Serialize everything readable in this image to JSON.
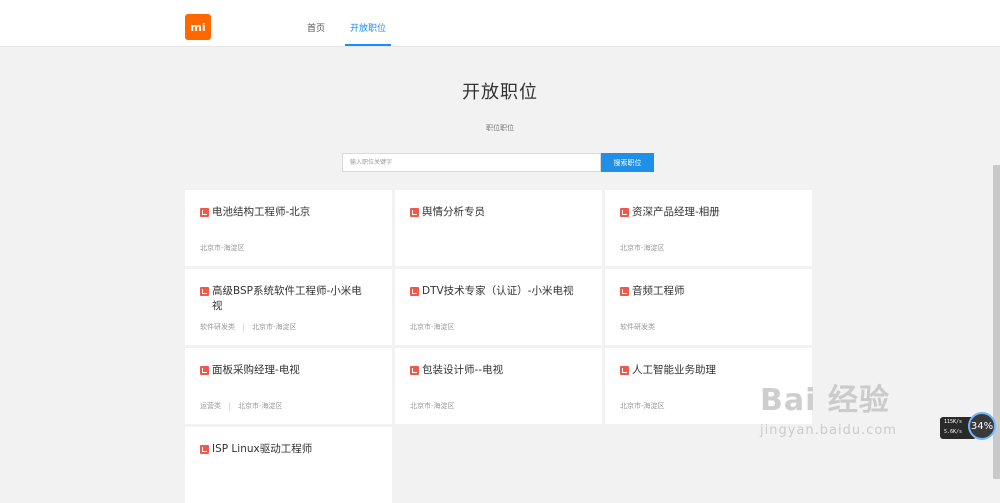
{
  "header": {
    "logo_text": "mi",
    "nav": [
      {
        "label": "首页",
        "active": false
      },
      {
        "label": "开放职位",
        "active": true
      }
    ]
  },
  "hero": {
    "title": "开放职位",
    "subtitle": "职位职位"
  },
  "search": {
    "placeholder": "输入职位关键字",
    "value": "",
    "button_label": "搜索职位"
  },
  "jobs": [
    {
      "title": "电池结构工程师-北京",
      "tags": [
        "北京市-海淀区"
      ]
    },
    {
      "title": "舆情分析专员",
      "tags": []
    },
    {
      "title": "资深产品经理-相册",
      "tags": [
        "北京市-海淀区"
      ]
    },
    {
      "title": "高级BSP系统软件工程师-小米电视",
      "tags": [
        "软件研发类",
        "北京市-海淀区"
      ]
    },
    {
      "title": "DTV技术专家（认证）-小米电视",
      "tags": [
        "北京市-海淀区"
      ]
    },
    {
      "title": "音频工程师",
      "tags": [
        "软件研发类"
      ]
    },
    {
      "title": "面板采购经理-电视",
      "tags": [
        "运营类",
        "北京市-海淀区"
      ]
    },
    {
      "title": "包装设计师--电视",
      "tags": [
        "北京市-海淀区"
      ]
    },
    {
      "title": "人工智能业务助理",
      "tags": [
        "北京市-海淀区"
      ]
    },
    {
      "title": "ISP Linux驱动工程师",
      "tags": []
    }
  ],
  "watermark": {
    "top": "Bai 经验",
    "bottom": "jingyan.baidu.com"
  },
  "net_widget": {
    "up": "115K/s",
    "down": "5.6K/s",
    "percent": "34%"
  },
  "colors": {
    "accent": "#1e90e8",
    "brand": "#ff6700",
    "icon": "#f2584a",
    "background": "#f2f2f2"
  }
}
